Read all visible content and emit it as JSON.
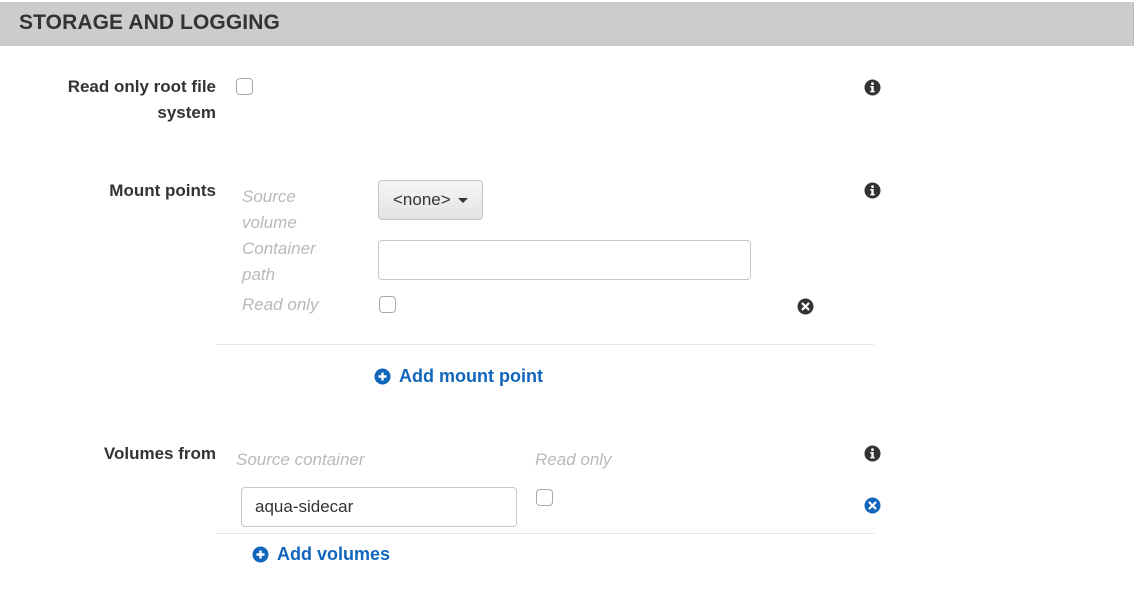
{
  "section": {
    "title": "STORAGE AND LOGGING"
  },
  "read_only_root": {
    "label_line1": "Read only root file",
    "label_line2": "system"
  },
  "mount_points": {
    "label": "Mount points",
    "source_volume_line1": "Source",
    "source_volume_line2": "volume",
    "container_path_line1": "Container",
    "container_path_line2": "path",
    "read_only_label": "Read only",
    "source_volume_value": "<none>",
    "container_path_value": "",
    "add_label": "Add mount point"
  },
  "volumes_from": {
    "label": "Volumes from",
    "source_container_header": "Source container",
    "read_only_header": "Read only",
    "source_container_value": "aqua-sidecar",
    "add_label": "Add volumes"
  },
  "colors": {
    "header_bg": "#cccccc",
    "link": "#1166bb",
    "muted_label": "#b9b9b9",
    "text": "#333333"
  }
}
